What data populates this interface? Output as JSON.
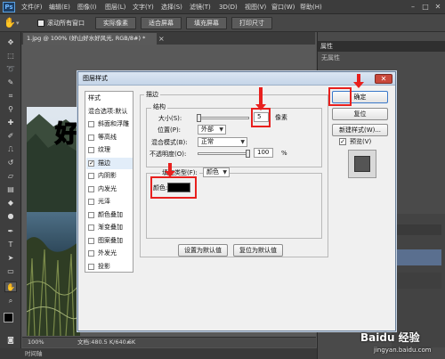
{
  "app": {
    "logo": "Ps",
    "menu": [
      "文件(F)",
      "编辑(E)",
      "图像(I)",
      "图层(L)",
      "文字(Y)",
      "选择(S)",
      "滤镜(T)",
      "3D(D)",
      "视图(V)",
      "窗口(W)",
      "帮助(H)"
    ],
    "window_controls": [
      "–",
      "□",
      "✕"
    ]
  },
  "options_bar": {
    "tool_icon": "hand-tool-icon",
    "scroll_all_windows": "滚动所有窗口",
    "buttons": [
      "实际像素",
      "适合屏幕",
      "填充屏幕",
      "打印尺寸"
    ]
  },
  "document": {
    "tab_label": "1.jpg @ 100% (好山好水好风光, RGB/8#) *",
    "tab_close": "×",
    "photo_text": "好",
    "zoom": "100%",
    "doc_info": "文档:480.5 K/640.6K"
  },
  "timeline": {
    "label": "时间轴"
  },
  "properties_panel": {
    "title": "属性",
    "message": "无属性"
  },
  "dialog": {
    "title": "图层样式",
    "close": "✕",
    "styles_list": [
      {
        "label": "样式",
        "checkbox": false,
        "checked": false,
        "selected": false
      },
      {
        "label": "混合选项:默认",
        "checkbox": false,
        "checked": false,
        "selected": false
      },
      {
        "label": "斜面和浮雕",
        "checkbox": true,
        "checked": false,
        "selected": false
      },
      {
        "label": "等高线",
        "checkbox": true,
        "checked": false,
        "selected": false
      },
      {
        "label": "纹理",
        "checkbox": true,
        "checked": false,
        "selected": false
      },
      {
        "label": "描边",
        "checkbox": true,
        "checked": true,
        "selected": true
      },
      {
        "label": "内阴影",
        "checkbox": true,
        "checked": false,
        "selected": false
      },
      {
        "label": "内发光",
        "checkbox": true,
        "checked": false,
        "selected": false
      },
      {
        "label": "光泽",
        "checkbox": true,
        "checked": false,
        "selected": false
      },
      {
        "label": "颜色叠加",
        "checkbox": true,
        "checked": false,
        "selected": false
      },
      {
        "label": "渐变叠加",
        "checkbox": true,
        "checked": false,
        "selected": false
      },
      {
        "label": "图案叠加",
        "checkbox": true,
        "checked": false,
        "selected": false
      },
      {
        "label": "外发光",
        "checkbox": true,
        "checked": false,
        "selected": false
      },
      {
        "label": "投影",
        "checkbox": true,
        "checked": false,
        "selected": false
      }
    ],
    "stroke_group": "描边",
    "structure_group": "结构",
    "size_label": "大小(S):",
    "size_value": "5",
    "size_unit": "像素",
    "position_label": "位置(P):",
    "position_value": "外部",
    "blend_mode_label": "混合模式(B):",
    "blend_mode_value": "正常",
    "opacity_label": "不透明度(O):",
    "opacity_value": "100",
    "opacity_unit": "%",
    "fill_type_label": "填充类型(F):",
    "fill_type_value": "颜色",
    "color_label": "颜色:",
    "stroke_color": "#000000",
    "set_default_button": "设置为默认值",
    "reset_default_button": "复位为默认值",
    "ok_button": "确定",
    "reset_button": "复位",
    "new_style_button": "新建样式(W)...",
    "preview_label": "预览(V)",
    "preview_checked": true
  },
  "watermark": {
    "brand": "Baidu 经验",
    "url": "jingyan.baidu.com"
  },
  "colors": {
    "highlight": "#e8201e",
    "photoshop_bg": "#535353",
    "dialog_bg": "#f0f0f0"
  }
}
